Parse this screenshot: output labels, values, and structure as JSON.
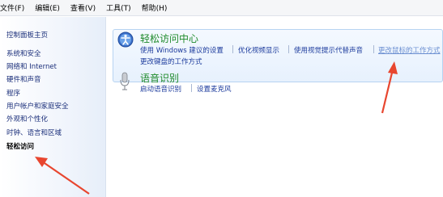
{
  "menubar": {
    "items": [
      "文件(F)",
      "编辑(E)",
      "查看(V)",
      "工具(T)",
      "帮助(H)"
    ]
  },
  "sidebar": {
    "items": [
      "控制面板主页",
      "系统和安全",
      "网络和 Internet",
      "硬件和声音",
      "程序",
      "用户帐户和家庭安全",
      "外观和个性化",
      "时钟、语言和区域",
      "轻松访问"
    ],
    "current": "轻松访问"
  },
  "categories": [
    {
      "title": "轻松访问中心",
      "icon": "ease-of-access-icon",
      "links_row1": [
        "使用 Windows 建议的设置",
        "优化视频显示",
        "使用视觉提示代替声音",
        "更改鼠标的工作方式"
      ],
      "links_row2": [
        "更改键盘的工作方式"
      ]
    },
    {
      "title": "语音识别",
      "icon": "microphone-icon",
      "links_row1": [
        "启动语音识别",
        "设置麦克风"
      ]
    }
  ],
  "colors": {
    "accent_arrow": "#e8462f",
    "category_title": "#1e8a2a",
    "link": "#1b3a9c"
  }
}
